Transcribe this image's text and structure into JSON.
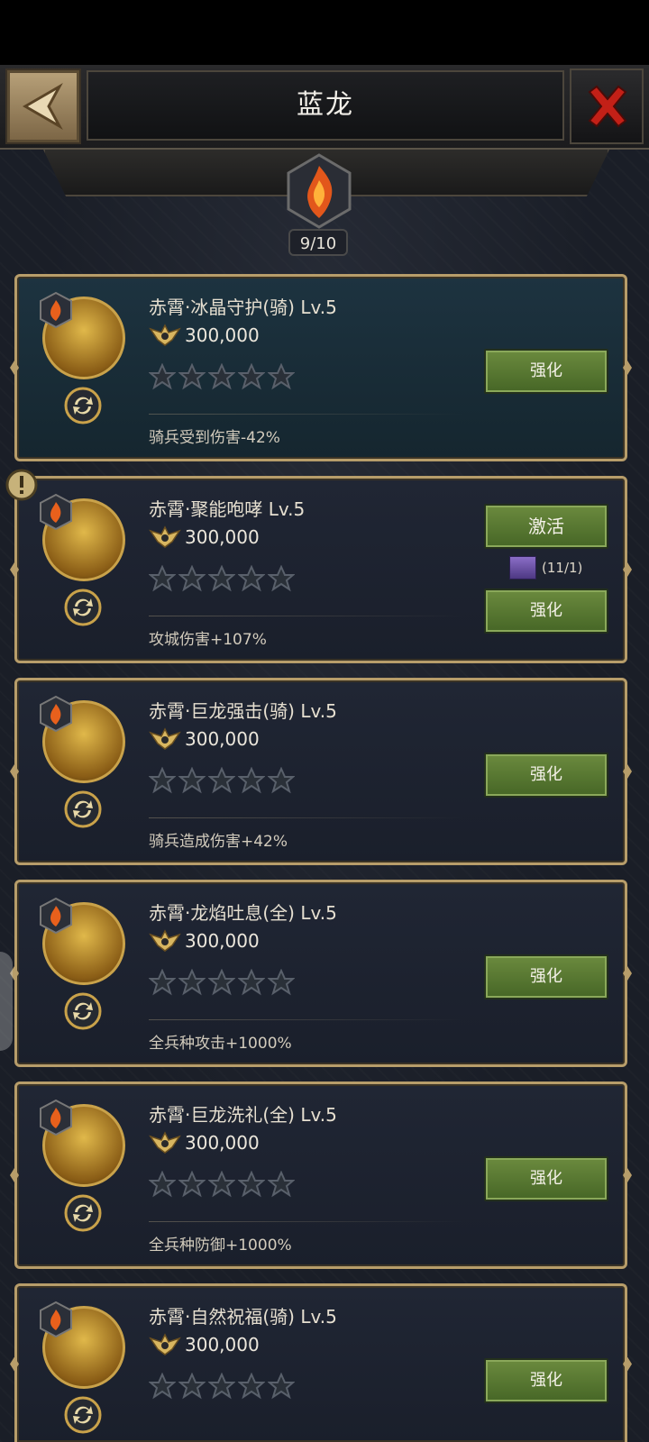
{
  "header": {
    "title": "蓝龙"
  },
  "progress": {
    "label": "9/10"
  },
  "colors": {
    "accent": "#b79d6a",
    "button": "#5b7a33"
  },
  "skills": [
    {
      "name": "赤霄·冰晶守护(骑) Lv.5",
      "cost": "300,000",
      "stars": 0,
      "effect": "骑兵受到伤害-42%",
      "button": "强化"
    },
    {
      "name": "赤霄·聚能咆哮 Lv.5",
      "cost": "300,000",
      "stars": 0,
      "effect": "攻城伤害+107%",
      "activate": "激活",
      "requirement": "(11/1)",
      "button": "强化"
    },
    {
      "name": "赤霄·巨龙强击(骑) Lv.5",
      "cost": "300,000",
      "stars": 0,
      "effect": "骑兵造成伤害+42%",
      "button": "强化"
    },
    {
      "name": "赤霄·龙焰吐息(全) Lv.5",
      "cost": "300,000",
      "stars": 0,
      "effect": "全兵种攻击+1000%",
      "button": "强化"
    },
    {
      "name": "赤霄·巨龙洗礼(全) Lv.5",
      "cost": "300,000",
      "stars": 0,
      "effect": "全兵种防御+1000%",
      "button": "强化"
    },
    {
      "name": "赤霄·自然祝福(骑) Lv.5",
      "cost": "300,000",
      "stars": 0,
      "effect": "",
      "button": "强化"
    }
  ],
  "icons": {
    "back": "back-arrow-icon",
    "close": "close-x-icon",
    "cost": "wing-coin-icon",
    "badge": "flame-badge-icon",
    "swap": "swap-icon",
    "star": "star-icon"
  }
}
